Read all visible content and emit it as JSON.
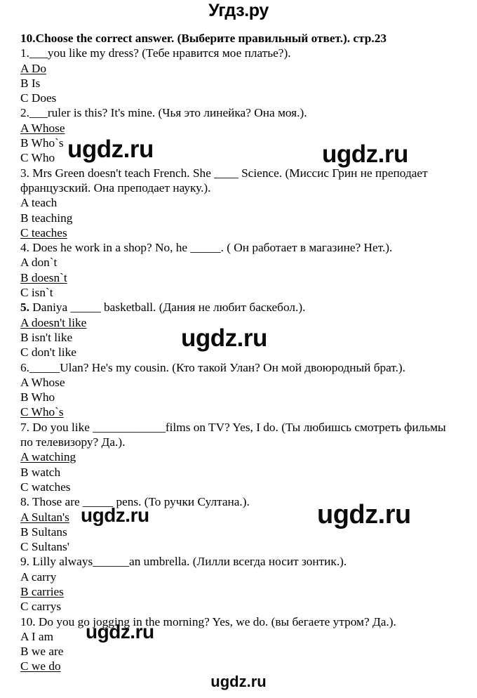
{
  "site": {
    "logo_text": "Угдз.ру"
  },
  "watermarks": [
    {
      "text": "ugdz.ru"
    },
    {
      "text": "ugdz.ru"
    },
    {
      "text": "ugdz.ru"
    },
    {
      "text": "ugdz.ru"
    },
    {
      "text": "ugdz.ru"
    },
    {
      "text": "ugdz.ru"
    },
    {
      "text": "ugdz.ru"
    }
  ],
  "exercise": {
    "title": "10.Choose the correct answer. (Выберите правильный ответ.). стр.23",
    "questions": [
      {
        "number": "1.",
        "number_bold": false,
        "prompt": "___you like my dress? (Тебе нравится мое платье?).",
        "options": [
          {
            "label": "A Do",
            "correct": true
          },
          {
            "label": "B Is",
            "correct": false
          },
          {
            "label": "C Does",
            "correct": false
          }
        ]
      },
      {
        "number": "2.",
        "number_bold": false,
        "prompt": "___ruler is this? It's mine. (Чья это линейка? Она моя.).",
        "options": [
          {
            "label": "A Whose",
            "correct": true
          },
          {
            "label": "B Who`s",
            "correct": false
          },
          {
            "label": "C Who",
            "correct": false
          }
        ]
      },
      {
        "number": "3.",
        "number_bold": false,
        "prompt": " Mrs Green doesn't teach French. She ____ Science. (Миссис Грин не преподает французский. Она преподает науку.).",
        "options": [
          {
            "label": "A teach",
            "correct": false
          },
          {
            "label": "B teaching",
            "correct": false
          },
          {
            "label": "C teaches",
            "correct": true
          }
        ]
      },
      {
        "number": "4.",
        "number_bold": false,
        "prompt": " Does he work in a shop? No, he _____. ( Он работает в магазине? Нет.).",
        "options": [
          {
            "label": "A don`t",
            "correct": false
          },
          {
            "label": "B doesn`t",
            "correct": true
          },
          {
            "label": "C isn`t",
            "correct": false
          }
        ]
      },
      {
        "number": "5.",
        "number_bold": true,
        "prompt": " Daniya _____ basketball. (Дания не любит баскебол.).",
        "options": [
          {
            "label": "A doesn't like",
            "correct": true
          },
          {
            "label": "B isn't like",
            "correct": false
          },
          {
            "label": "C don't like",
            "correct": false
          }
        ]
      },
      {
        "number": "6.",
        "number_bold": false,
        "prompt": "_____Ulan? He's my cousin. (Кто такой Улан? Он мой двоюродный брат.).",
        "options": [
          {
            "label": "A Whose",
            "correct": false
          },
          {
            "label": "B Who",
            "correct": false
          },
          {
            "label": "C Who`s",
            "correct": true
          }
        ]
      },
      {
        "number": "7.",
        "number_bold": false,
        "prompt": " Do you like ____________films on TV? Yes, I do. (Ты любишсь смотреть фильмы по телевизору? Да.).",
        "options": [
          {
            "label": "A watching",
            "correct": true
          },
          {
            "label": "B watch",
            "correct": false
          },
          {
            "label": "C watches",
            "correct": false
          }
        ]
      },
      {
        "number": "8.",
        "number_bold": false,
        "prompt": " Those are _____ pens. (То ручки Султана.).",
        "options": [
          {
            "label": "A Sultan's",
            "correct": true
          },
          {
            "label": "B Sultans",
            "correct": false
          },
          {
            "label": "C Sultans'",
            "correct": false
          }
        ]
      },
      {
        "number": "9.",
        "number_bold": false,
        "prompt": " Lilly always______an umbrella. (Лилли всегда носит зонтик.).",
        "options": [
          {
            "label": "A carry",
            "correct": false
          },
          {
            "label": "B carries",
            "correct": true
          },
          {
            "label": "C carrys",
            "correct": false
          }
        ]
      },
      {
        "number": "10.",
        "number_bold": false,
        "prompt": " Do you go jogging in the morning? Yes, we do. (вы бегаете утром? Да.).",
        "options": [
          {
            "label": "A I am",
            "correct": false
          },
          {
            "label": "B we are",
            "correct": false
          },
          {
            "label": "C we do",
            "correct": true
          }
        ]
      }
    ]
  }
}
